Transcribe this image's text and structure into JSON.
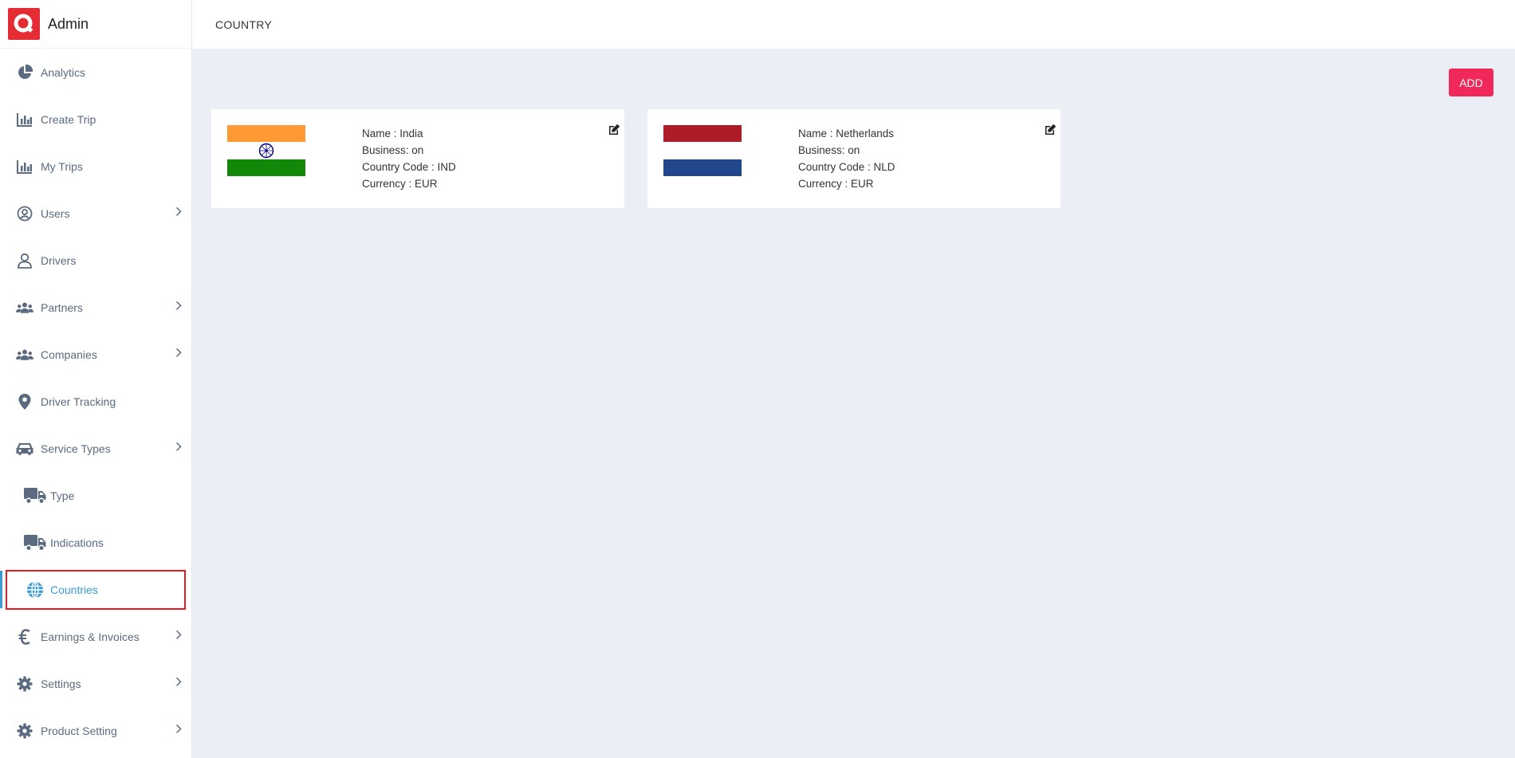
{
  "brand": {
    "title": "Admin"
  },
  "header": {
    "title": "COUNTRY"
  },
  "toolbar": {
    "add_label": "ADD"
  },
  "sidebar": {
    "items": [
      {
        "label": "Analytics",
        "icon": "pie-chart-icon"
      },
      {
        "label": "Create Trip",
        "icon": "bar-chart-icon"
      },
      {
        "label": "My Trips",
        "icon": "bar-chart-icon"
      },
      {
        "label": "Users",
        "icon": "user-circle-icon"
      },
      {
        "label": "Drivers",
        "icon": "user-icon"
      },
      {
        "label": "Partners",
        "icon": "users-icon"
      },
      {
        "label": "Companies",
        "icon": "users-icon"
      },
      {
        "label": "Driver Tracking",
        "icon": "map-pin-icon"
      },
      {
        "label": "Service Types",
        "icon": "car-icon"
      },
      {
        "label": "Type",
        "icon": "truck-icon"
      },
      {
        "label": "Indications",
        "icon": "truck-icon"
      },
      {
        "label": "Countries",
        "icon": "globe-icon"
      },
      {
        "label": "Earnings & Invoices",
        "icon": "euro-icon"
      },
      {
        "label": "Settings",
        "icon": "gear-icon"
      },
      {
        "label": "Product Setting",
        "icon": "gear-icon"
      }
    ]
  },
  "countries": [
    {
      "name_line": "Name : India",
      "business_line": "Business: on",
      "code_line": "Country Code : IND",
      "currency_line": "Currency : EUR",
      "flag": {
        "top": "#ff9933",
        "middle": "#ffffff",
        "bottom": "#138808",
        "emblem": "#000080"
      }
    },
    {
      "name_line": "Name : Netherlands",
      "business_line": "Business: on",
      "code_line": "Country Code : NLD",
      "currency_line": "Currency : EUR",
      "flag": {
        "top": "#ae1c28",
        "middle": "#ffffff",
        "bottom": "#21468b"
      }
    }
  ],
  "colors": {
    "accent": "#3a9bd6",
    "brand": "#e52b33",
    "add_button": "#f1295a",
    "highlight_border": "#e51c23"
  }
}
